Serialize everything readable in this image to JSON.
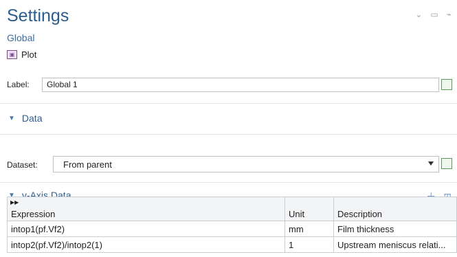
{
  "header": {
    "title": "Settings",
    "subtitle": "Global",
    "plot_label": "Plot",
    "plot_icon": "plot-icon"
  },
  "window_controls": {
    "collapse_icon": "chevron-down-icon",
    "maximize_icon": "maximize-icon",
    "pin_icon": "pin-icon"
  },
  "label_field": {
    "label": "Label:",
    "value": "Global 1"
  },
  "data_section": {
    "title": "Data",
    "dataset_label": "Dataset:",
    "dataset_value": "From parent"
  },
  "yaxis_section": {
    "title": "y-Axis Data",
    "toolbar": {
      "move_left_icon": "arrow-left-icon",
      "move_right_icon": "arrow-right-icon",
      "add_icon": "plus-icon",
      "table_icon": "table-settings-icon"
    }
  },
  "table": {
    "headers": [
      "Expression",
      "Unit",
      "Description"
    ],
    "rows": [
      [
        "intop1(pf.Vf2)",
        "mm",
        "Film thickness"
      ],
      [
        "intop2(pf.Vf2)/intop2(1)",
        "1",
        "Upstream meniscus relati..."
      ]
    ]
  },
  "colors": {
    "accent": "#2a5d8f",
    "border": "#c9cdd1"
  }
}
